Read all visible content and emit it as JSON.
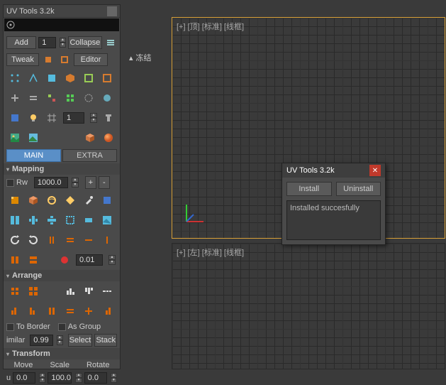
{
  "title": "UV Tools 3.2k",
  "toolbar": {
    "add": "Add",
    "add_count": "1",
    "collapse": "Collapse",
    "tweak": "Tweak",
    "editor": "Editor"
  },
  "grid_count": "1",
  "tabs": {
    "main": "MAIN",
    "extra": "EXTRA"
  },
  "mapping": {
    "title": "Mapping",
    "rw": "Rw",
    "rw_val": "1000.0",
    "plus": "+",
    "minus": "-",
    "scale": "0.01"
  },
  "arrange": {
    "title": "Arrange",
    "to_border": "To Border",
    "as_group": "As Group",
    "similar": "imilar",
    "sim_val": "0.99",
    "select": "Select",
    "stack": "Stack"
  },
  "transform": {
    "title": "Transform",
    "move": "Move",
    "scale": "Scale",
    "rotate": "Rotate",
    "u": "u",
    "v1": "0.0",
    "v2": "100.0",
    "v3": "0.0"
  },
  "viewport": {
    "top": "[+] [顶] [标准] [线框]",
    "left": "[+] [左] [标准] [线框]"
  },
  "freeze": "冻结",
  "dialog": {
    "title": "UV Tools 3.2k",
    "install": "Install",
    "uninstall": "Uninstall",
    "message": "Installed succesfully"
  }
}
